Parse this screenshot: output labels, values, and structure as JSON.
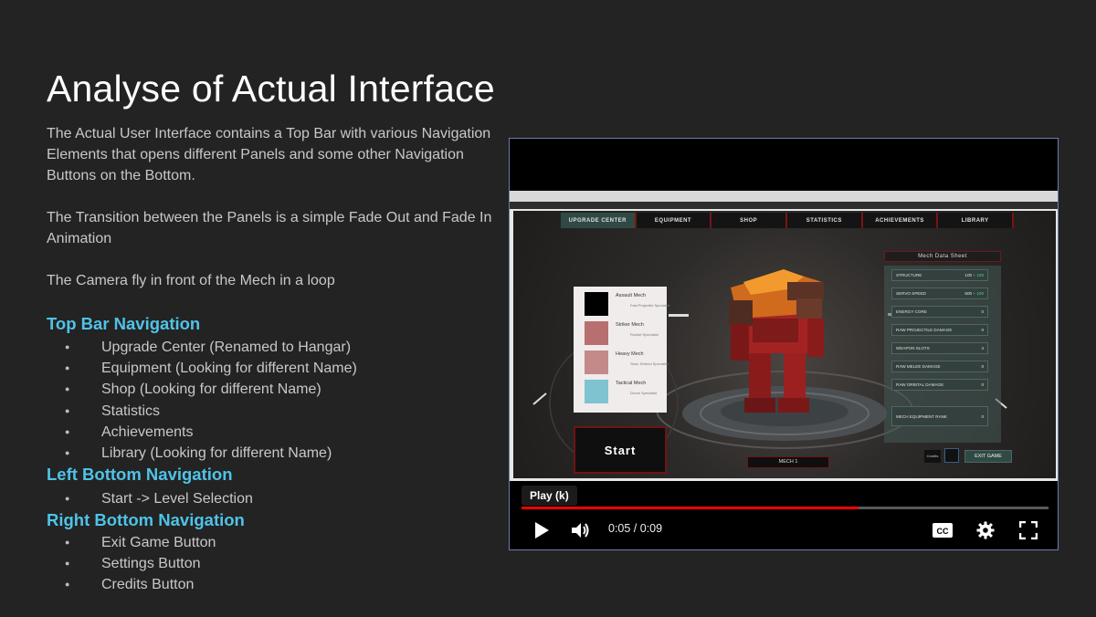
{
  "slide": {
    "title": "Analyse of Actual Interface",
    "paragraphs": [
      "The Actual User Interface contains a Top Bar with various Navigation Elements that opens different Panels and some other Navigation Buttons on the Bottom.",
      "The Transition between the Panels is a simple Fade Out and Fade In Animation",
      "The Camera fly in front of the Mech in a loop"
    ],
    "sections": [
      {
        "heading": "Top Bar Navigation",
        "items": [
          "Upgrade Center (Renamed to Hangar)",
          "Equipment (Looking for different Name)",
          "Shop (Looking for different Name)",
          "Statistics",
          "Achievements",
          "Library (Looking for different Name)"
        ]
      },
      {
        "heading": "Left Bottom Navigation",
        "items": [
          "Start -> Level Selection"
        ]
      },
      {
        "heading": "Right Bottom Navigation",
        "items": [
          "Exit Game Button",
          "Settings Button",
          "Credits Button"
        ]
      }
    ],
    "colors": {
      "background": "#232323",
      "title": "#ffffff",
      "body_text": "#c8c8c8",
      "heading": "#4fc3e8"
    }
  },
  "video": {
    "tooltip": "Play (k)",
    "time_display": "0:05 / 0:09",
    "progress": 0.64,
    "icons": [
      "play-icon",
      "volume-icon",
      "closed-captions-icon",
      "settings-gear-icon",
      "fullscreen-icon"
    ],
    "colors": {
      "progress": "#ff0000",
      "frame_border": "#6a7fa8"
    },
    "game": {
      "tabs": [
        "Upgrade Center",
        "Equipment",
        "Shop",
        "Statistics",
        "Achievements",
        "Library"
      ],
      "active_tab": "Upgrade Center",
      "mech_list": [
        {
          "name": "Assault Mech",
          "sub": "Fast Projectile Specialist",
          "color": "#000000"
        },
        {
          "name": "Striker Mech",
          "sub": "Rocket Specialist",
          "color": "#b86f6f"
        },
        {
          "name": "Heavy Mech",
          "sub": "Slow, Defend Specialist",
          "color": "#c48a8a"
        },
        {
          "name": "Tactical Mech",
          "sub": "Drone Specialist",
          "color": "#7ec3cf"
        }
      ],
      "start_label": "Start",
      "datasheet_title": "Mech Data Sheet",
      "stats": [
        {
          "label": "Structure",
          "value": "100",
          "bonus": "+ 100"
        },
        {
          "label": "Servo Speed",
          "value": "600",
          "bonus": "+ 100"
        },
        {
          "label": "Energy Core",
          "value": "0",
          "bonus": ""
        },
        {
          "label": "Raw Projectile Damage",
          "value": "0",
          "bonus": ""
        },
        {
          "label": "Weapon Slots",
          "value": "4",
          "bonus": ""
        },
        {
          "label": "Raw Melee Damage",
          "value": "0",
          "bonus": ""
        },
        {
          "label": "Raw Orbital Damage",
          "value": "0",
          "bonus": ""
        }
      ],
      "equipment_rank": {
        "label": "Mech Equipment Rank",
        "value": "0"
      },
      "mech_label": "Mech 1",
      "credits_label": "Credits",
      "exit_label": "Exit Game"
    }
  }
}
